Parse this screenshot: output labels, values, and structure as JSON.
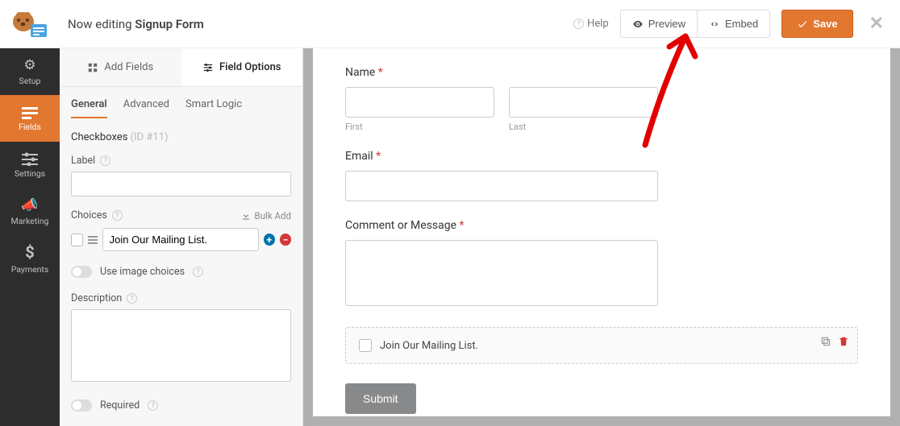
{
  "header": {
    "title_prefix": "Now editing ",
    "form_name": "Signup Form",
    "help": "Help",
    "preview": "Preview",
    "embed": "Embed",
    "save": "Save"
  },
  "leftnav": {
    "setup": "Setup",
    "fields": "Fields",
    "settings": "Settings",
    "marketing": "Marketing",
    "payments": "Payments"
  },
  "panel": {
    "add_fields": "Add Fields",
    "field_options": "Field Options",
    "general": "General",
    "advanced": "Advanced",
    "smart_logic": "Smart Logic",
    "field_type": "Checkboxes",
    "field_id": "(ID #11)",
    "label_lbl": "Label",
    "label_val": "",
    "choices_lbl": "Choices",
    "bulk_add": "Bulk Add",
    "choice1": "Join Our Mailing List.",
    "image_choices": "Use image choices",
    "description_lbl": "Description",
    "description_val": "",
    "required": "Required"
  },
  "form": {
    "name_lbl": "Name",
    "first": "First",
    "last": "Last",
    "email_lbl": "Email",
    "comment_lbl": "Comment or Message",
    "checkbox_text": "Join Our Mailing List.",
    "submit": "Submit"
  }
}
